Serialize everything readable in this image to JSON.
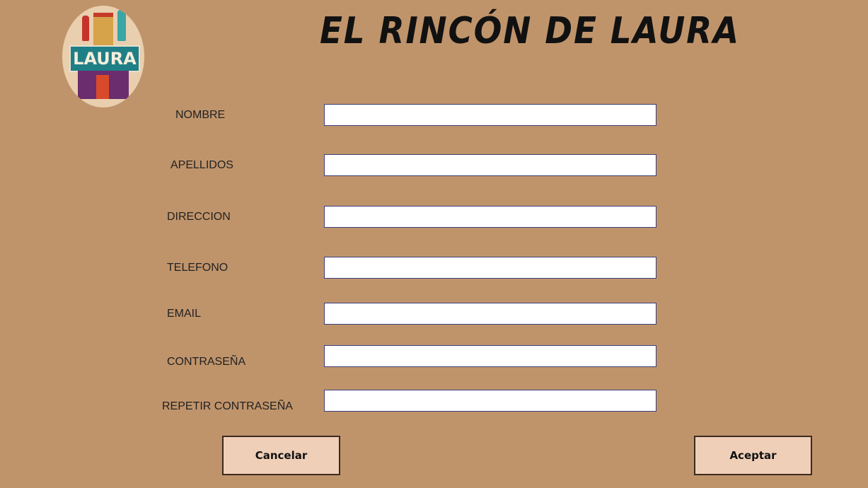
{
  "header": {
    "title": "EL RINCÓN DE LAURA",
    "logo_text": "LAURA"
  },
  "form": {
    "fields": [
      {
        "label": "NOMBRE",
        "value": ""
      },
      {
        "label": "APELLIDOS",
        "value": ""
      },
      {
        "label": "DIRECCION",
        "value": ""
      },
      {
        "label": "TELEFONO",
        "value": ""
      },
      {
        "label": "EMAIL",
        "value": ""
      },
      {
        "label": "CONTRASEÑA",
        "value": ""
      },
      {
        "label": "REPETIR CONTRASEÑA",
        "value": ""
      }
    ]
  },
  "buttons": {
    "cancel": "Cancelar",
    "accept": "Aceptar"
  }
}
